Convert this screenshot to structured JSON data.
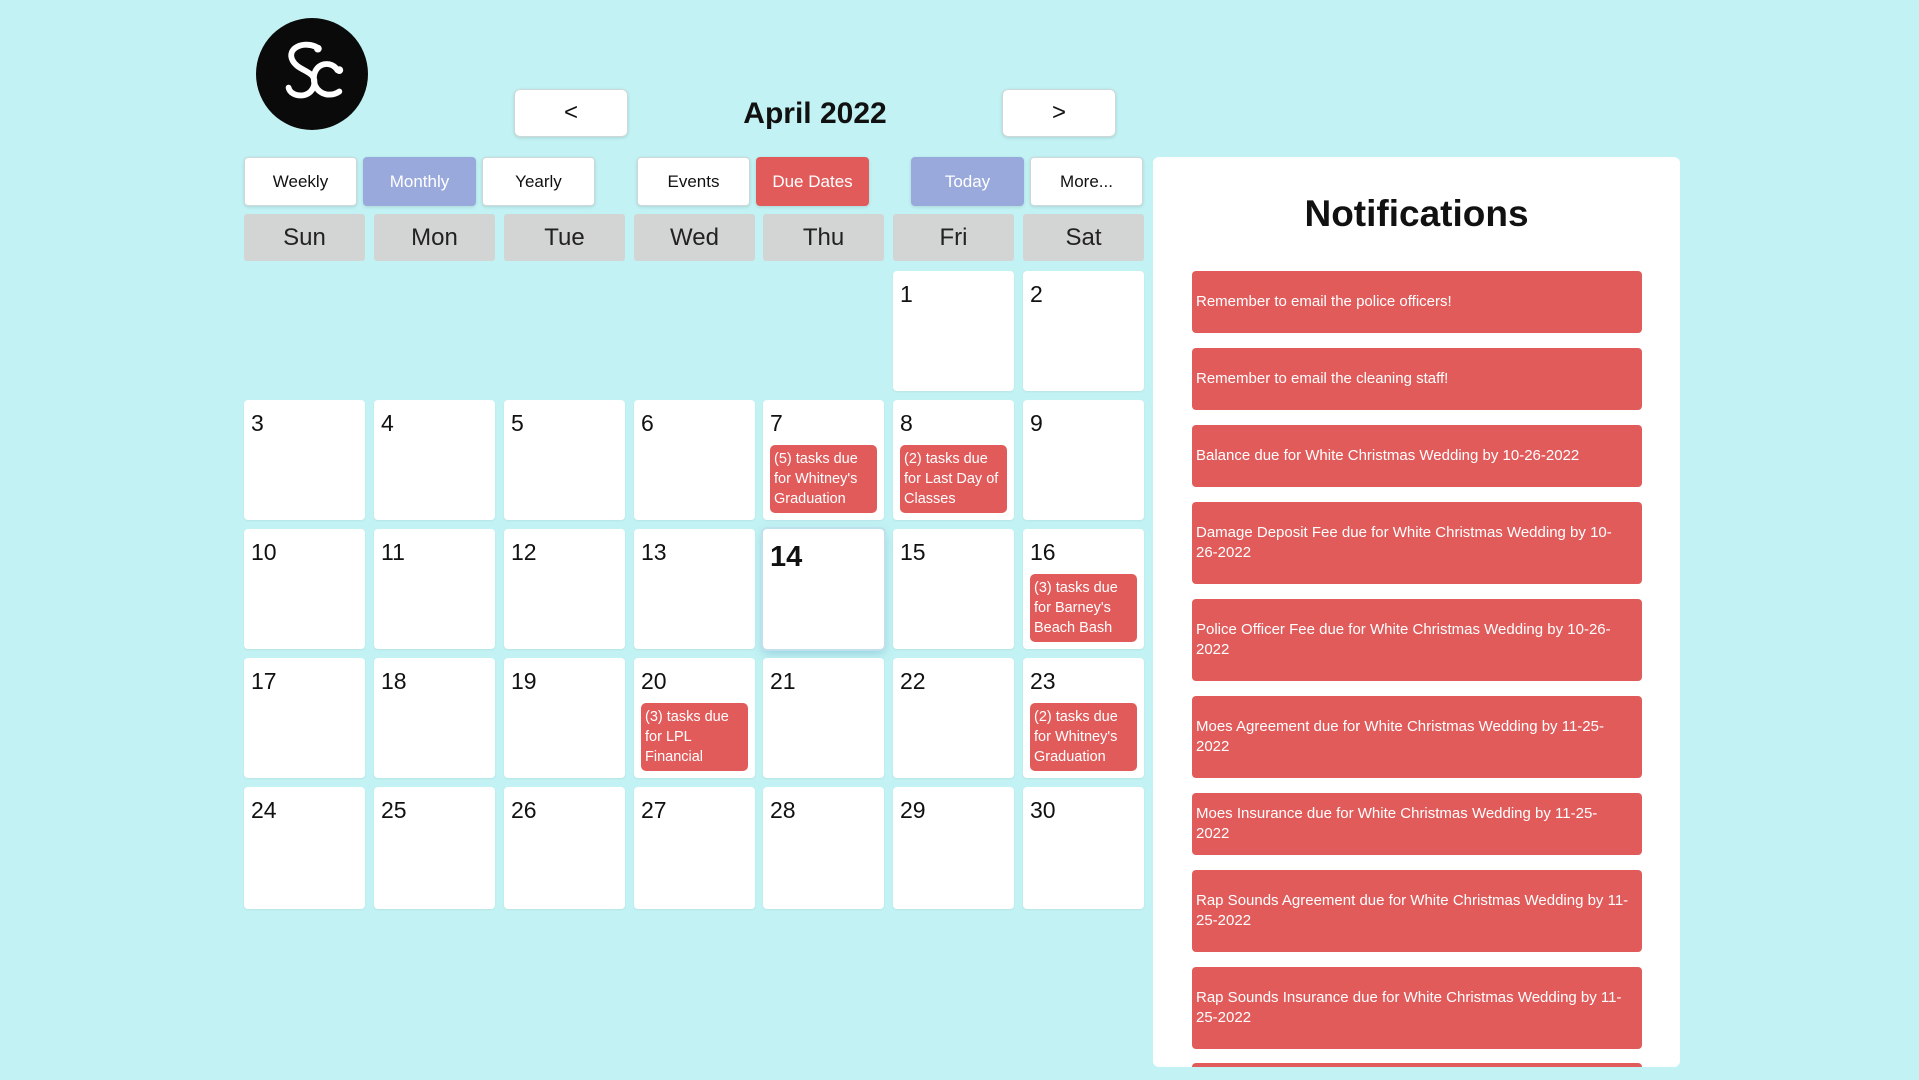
{
  "logo": {
    "text": "SC"
  },
  "header": {
    "prev_label": "<",
    "next_label": ">",
    "month_title": "April 2022"
  },
  "views": {
    "weekly": "Weekly",
    "monthly": "Monthly",
    "yearly": "Yearly",
    "events": "Events",
    "due_dates": "Due Dates",
    "today": "Today",
    "more": "More..."
  },
  "weekdays": [
    "Sun",
    "Mon",
    "Tue",
    "Wed",
    "Thu",
    "Fri",
    "Sat"
  ],
  "days": {
    "d1": "1",
    "d2": "2",
    "d3": "3",
    "d4": "4",
    "d5": "5",
    "d6": "6",
    "d7": "7",
    "d8": "8",
    "d9": "9",
    "d10": "10",
    "d11": "11",
    "d12": "12",
    "d13": "13",
    "d14": "14",
    "d15": "15",
    "d16": "16",
    "d17": "17",
    "d18": "18",
    "d19": "19",
    "d20": "20",
    "d21": "21",
    "d22": "22",
    "d23": "23",
    "d24": "24",
    "d25": "25",
    "d26": "26",
    "d27": "27",
    "d28": "28",
    "d29": "29",
    "d30": "30"
  },
  "tasks": {
    "d7": "(5) tasks due for Whitney's Graduation",
    "d8": "(2) tasks due for Last Day of Classes",
    "d16": "(3) tasks due for Barney's Beach Bash",
    "d20": "(3) tasks due for LPL Financial",
    "d23": "(2) tasks due for Whitney's Graduation"
  },
  "notifications": {
    "title": "Notifications",
    "items": [
      "Remember to email the police officers!",
      "Remember to email the cleaning staff!",
      "Balance due for White Christmas Wedding by 10-26-2022",
      "Damage Deposit Fee due for White Christmas Wedding by 10-26-2022",
      "Police Officer Fee due for White Christmas Wedding by 10-26-2022",
      "Moes Agreement due for White Christmas Wedding by 11-25-2022",
      "Moes Insurance due for White Christmas Wedding by 11-25-2022",
      "Rap Sounds Agreement due for White Christmas Wedding by 11-25-2022",
      "Rap Sounds Insurance due for White Christmas Wedding by 11-25-2022"
    ]
  },
  "colors": {
    "background": "#c2f2f3",
    "accent_blue": "#9aa9dc",
    "accent_red": "#e25b5b",
    "weekday_header": "#d3d4d4"
  }
}
